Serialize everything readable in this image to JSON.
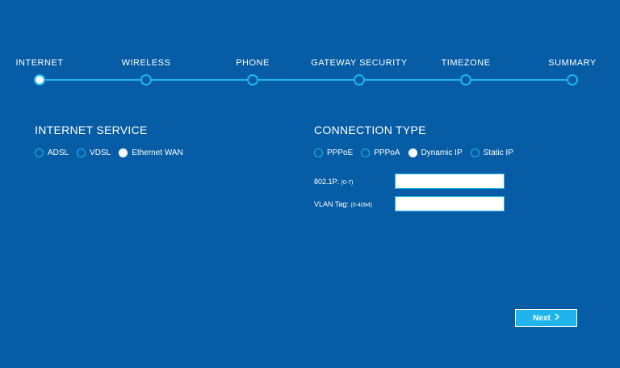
{
  "stepper": {
    "steps": [
      {
        "label": "INTERNET"
      },
      {
        "label": "WIRELESS"
      },
      {
        "label": "PHONE"
      },
      {
        "label": "GATEWAY SECURITY"
      },
      {
        "label": "TIMEZONE"
      },
      {
        "label": "SUMMARY"
      }
    ],
    "active_step": "INTERNET"
  },
  "internet_service": {
    "title": "INTERNET SERVICE",
    "options": [
      {
        "label": "ADSL",
        "checked": false
      },
      {
        "label": "VDSL",
        "checked": false
      },
      {
        "label": "Ethernet WAN",
        "checked": true
      }
    ]
  },
  "connection_type": {
    "title": "CONNECTION TYPE",
    "options": [
      {
        "label": "PPPoE",
        "checked": false
      },
      {
        "label": "PPPoA",
        "checked": false
      },
      {
        "label": "Dynamic IP",
        "checked": true
      },
      {
        "label": "Static IP",
        "checked": false
      }
    ],
    "fields": [
      {
        "label": "802.1P:",
        "hint": "(0-7)",
        "value": ""
      },
      {
        "label": "VLAN Tag:",
        "hint": "(0-4094)",
        "value": ""
      }
    ]
  },
  "actions": {
    "next_label": "Next",
    "next_icon": "chevron-right-icon"
  },
  "colors": {
    "background": "#065da5",
    "accent": "#1fb5ec",
    "text": "#ffffff"
  }
}
